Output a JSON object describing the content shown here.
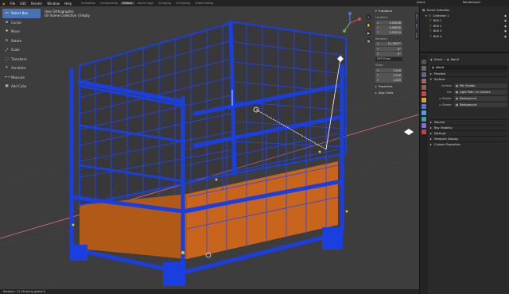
{
  "topbar": {
    "menus": [
      "File",
      "Edit",
      "Render",
      "Window",
      "Help"
    ],
    "workspaces": [
      "Animation",
      "Compositing",
      "Default",
      "Game Logic",
      "Scripting",
      "UV Editing",
      "Video Editing"
    ],
    "active_workspace": "Default",
    "scene": "Scene",
    "view_layer": "RenderLayer"
  },
  "toolbar": {
    "tools": [
      {
        "label": "Select Box",
        "icon": "▭",
        "active": true
      },
      {
        "label": "Cursor",
        "icon": "⊕",
        "active": false
      },
      {
        "label": "Move",
        "icon": "✥",
        "active": false
      },
      {
        "label": "Rotate",
        "icon": "↻",
        "active": false
      },
      {
        "label": "Scale",
        "icon": "⤢",
        "active": false
      },
      {
        "label": "Transform",
        "icon": "⬚",
        "active": false
      },
      {
        "label": "Annotate",
        "icon": "✎",
        "active": false
      },
      {
        "label": "Measure",
        "icon": "📏",
        "active": false
      },
      {
        "label": "Add Cube",
        "icon": "▣",
        "active": false
      }
    ]
  },
  "viewport": {
    "view_name": "User Orthographic",
    "collection": "(0) Scene Collection | Empty",
    "status_text": "Rotation: 11.39 along global X"
  },
  "n_panel": {
    "transform_header": "Transform",
    "location_label": "Location:",
    "location": [
      {
        "axis": "X",
        "value": "2.29508"
      },
      {
        "axis": "Y",
        "value": "0.90835"
      },
      {
        "axis": "Z",
        "value": "0.53519"
      }
    ],
    "rotation_label": "Rotation:",
    "rotation": [
      {
        "axis": "X",
        "value": "11.3927°"
      },
      {
        "axis": "Y",
        "value": "0°"
      },
      {
        "axis": "Z",
        "value": "0°"
      }
    ],
    "rotation_mode": "XYZ Euler",
    "scale_label": "Scale:",
    "scale": [
      {
        "axis": "X",
        "value": "1.000"
      },
      {
        "axis": "Y",
        "value": "1.000"
      },
      {
        "axis": "Z",
        "value": "1.000"
      }
    ],
    "properties_header": "Properties",
    "align_header": "Align Tools",
    "tabs": [
      "Item",
      "Tool",
      "View"
    ]
  },
  "outliner": {
    "header": "Scene Collection",
    "items": [
      "Collection 1",
      "BOX 1",
      "BOX 2",
      "BOX 3",
      "BOX 4"
    ]
  },
  "properties": {
    "scene_label": "Scene",
    "world_label": "World",
    "world_name": "World",
    "preview": "Preview",
    "surface_header": "Surface",
    "surface_key": "Surface",
    "surface_value": "Mix Shader",
    "fac_key": "Fac",
    "fac_value": "Light Path | Is Camera",
    "shader1_key": "Shader",
    "shader1_value": "Background",
    "shader2_key": "Shader",
    "shader2_value": "Background",
    "sections": [
      "Volume",
      "Ray Visibility",
      "Settings",
      "Viewport Display",
      "Custom Properties"
    ]
  },
  "colors": {
    "accent": "#4772b3",
    "cage": "#1a3fe0",
    "floor": "#c8641c",
    "viewport_bg": "#3d3d3d"
  }
}
